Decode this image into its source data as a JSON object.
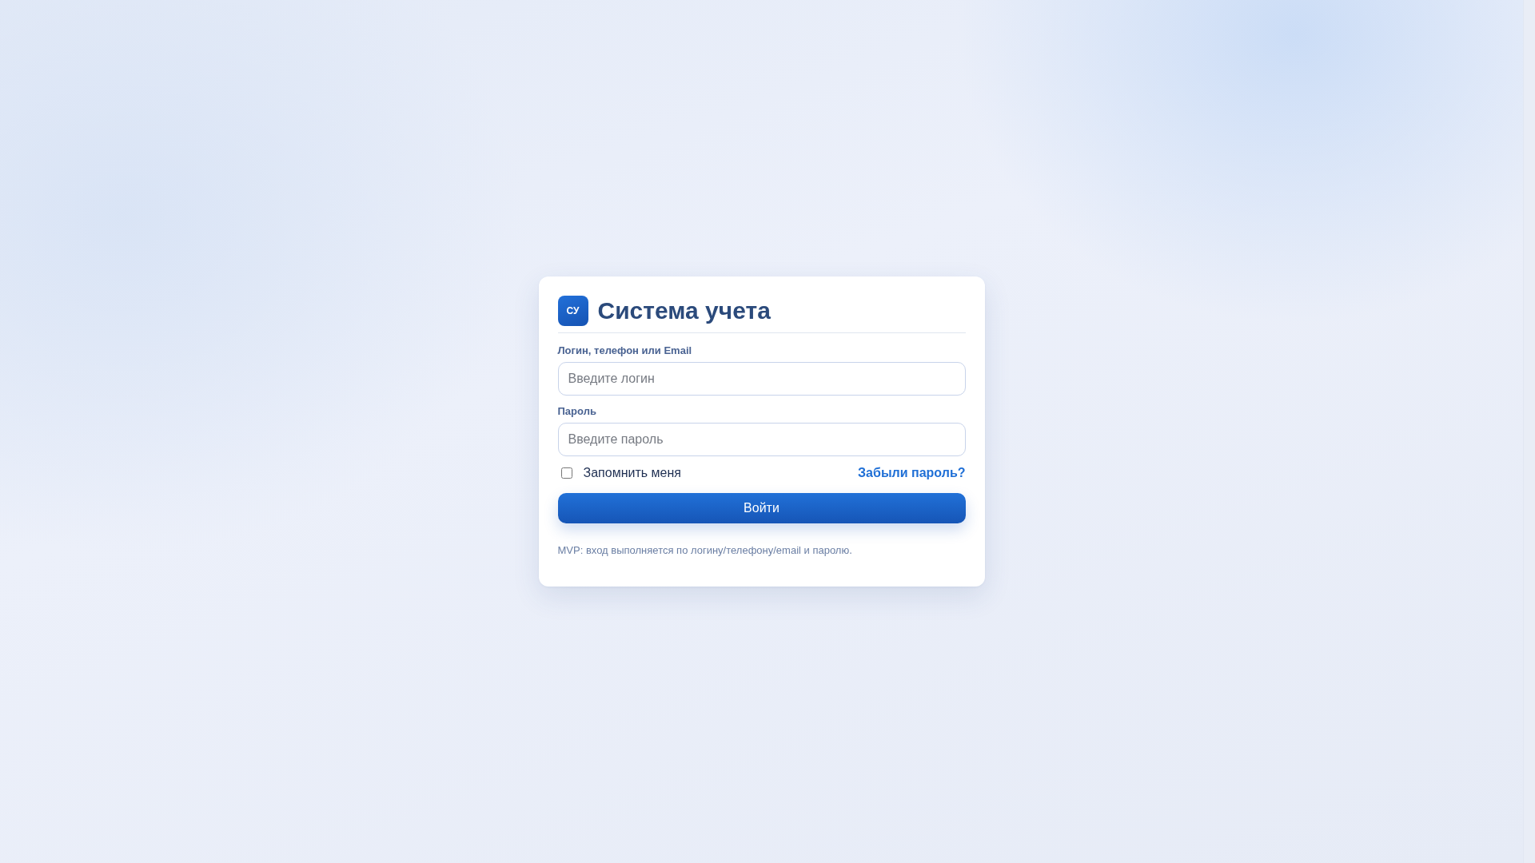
{
  "header": {
    "logo": "СУ",
    "title": "Система учета"
  },
  "fields": [
    {
      "label": "Логин, телефон или Email",
      "placeholder": "Введите логин"
    },
    {
      "label": "Пароль",
      "placeholder": "Введите пароль"
    }
  ],
  "remember": {
    "label": "Запомнить меня",
    "checked": false
  },
  "forgot_link": "Забыли пароль?",
  "submit_button": "Войти",
  "note": "MVP: вход выполняется по логину/телефону/email и паролю."
}
